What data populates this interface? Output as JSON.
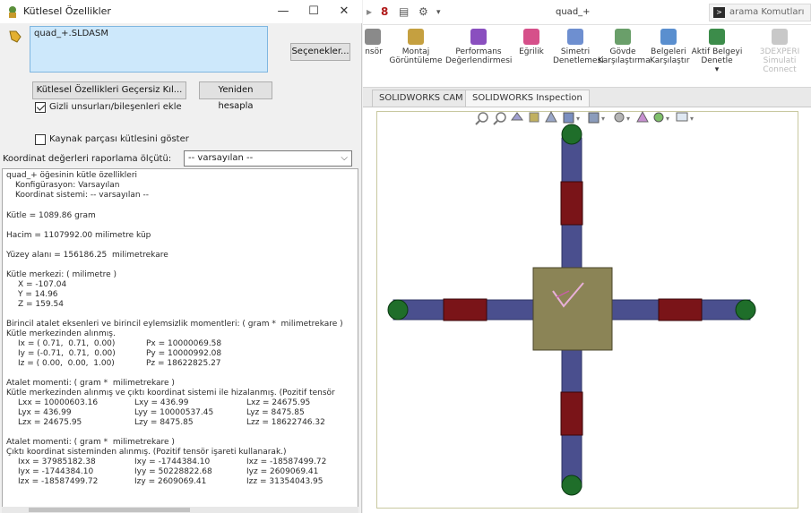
{
  "dialog": {
    "title": "Kütlesel Özellikler",
    "file_name": "quad_+.SLDASM",
    "options_label": "Seçenekler...",
    "override_label": "Kütlesel Özellikleri Geçersiz Kıl...",
    "recalc_label": "Yeniden hesapla",
    "include_hidden_label": "Gizli unsurları/bileşenleri ekle",
    "include_hidden_checked": true,
    "show_source_label": "Kaynak parçası kütlesini göster",
    "show_source_checked": false,
    "report_coord_label": "Koordinat değerleri raporlama ölçütü:",
    "report_coord_value": "-- varsayılan --",
    "results": {
      "header": "quad_+ öğesinin kütle özellikleri",
      "config": "Konfigürasyon: Varsayılan",
      "coord_system": "Koordinat sistemi: -- varsayılan --",
      "mass": "Kütle = 1089.86 gram",
      "volume": "Hacim = 1107992.00 milimetre küp",
      "surface_area": "Yüzey alanı = 156186.25  milimetrekare",
      "com_title": "Kütle merkezi: ( milimetre )",
      "com_x": "X = -107.04",
      "com_y": "Y = 14.96",
      "com_z": "Z = 159.54",
      "principal_title": "Birincil atalet eksenleri ve birincil eylemsizlik momentleri: ( gram *  milimetrekare )",
      "principal_sub": "Kütle merkezinden alınmış.",
      "ix": "Ix = ( 0.71,  0.71,  0.00)",
      "px": "Px = 10000069.58",
      "iy": "Iy = (-0.71,  0.71,  0.00)",
      "py": "Py = 10000992.08",
      "iz": "Iz = ( 0.00,  0.00,  1.00)",
      "pz": "Pz = 18622825.27",
      "inertia1_title": "Atalet momenti: ( gram *  milimetrekare )",
      "inertia1_sub": "Kütle merkezinden alınmış ve çıktı koordinat sistemi ile hizalanmış. (Pozitif tensör",
      "lxx": "Lxx = 10000603.16",
      "lxy": "Lxy = 436.99",
      "lxz": "Lxz = 24675.95",
      "lyx": "Lyx = 436.99",
      "lyy": "Lyy = 10000537.45",
      "lyz": "Lyz = 8475.85",
      "lzx": "Lzx = 24675.95",
      "lzy": "Lzy = 8475.85",
      "lzz": "Lzz = 18622746.32",
      "inertia2_title": "Atalet momenti: ( gram *  milimetrekare )",
      "inertia2_sub": "Çıktı koordinat sisteminden alınmış. (Pozitif tensör işareti kullanarak.)",
      "ixx": "Ixx = 37985182.38",
      "ixy": "Ixy = -1744384.10",
      "ixz": "Ixz = -18587499.72",
      "iyx": "Iyx = -1744384.10",
      "iyy": "Iyy = 50228822.68",
      "iyz": "Iyz = 2609069.41",
      "izx": "Izx = -18587499.72",
      "izy": "Izy = 2609069.41",
      "izz": "Izz = 31354043.95"
    }
  },
  "solidworks": {
    "doc_title": "quad_+",
    "search_label": "arama Komutları",
    "ribbon": [
      {
        "label": "nsör",
        "icon": "sensor-icon"
      },
      {
        "label": "Montaj\nGörüntüleme",
        "icon": "assembly-visualization-icon"
      },
      {
        "label": "Performans\nDeğerlendirmesi",
        "icon": "performance-evaluation-icon"
      },
      {
        "label": "Eğrilik",
        "icon": "curvature-icon"
      },
      {
        "label": "Simetri\nDenetlemesi",
        "icon": "symmetry-check-icon"
      },
      {
        "label": "Gövde\nKarşılaştırma",
        "icon": "compare-bodies-icon"
      },
      {
        "label": "Belgeleri\nKarşılaştır",
        "icon": "compare-documents-icon"
      },
      {
        "label": "Aktif Belgeyi\nDenetle",
        "icon": "check-active-document-icon"
      },
      {
        "label": "3DEXPERI\nSimulati\nConnect",
        "icon": "3dexperience-icon"
      }
    ],
    "tabs": [
      "SOLIDWORKS CAM",
      "SOLIDWORKS Inspection"
    ]
  },
  "colors": {
    "arm": "#4a4f8e",
    "motor": "#7a1418",
    "rotor": "#1f6e2a",
    "body": "#8b8456",
    "selection": "#cde8fb"
  }
}
